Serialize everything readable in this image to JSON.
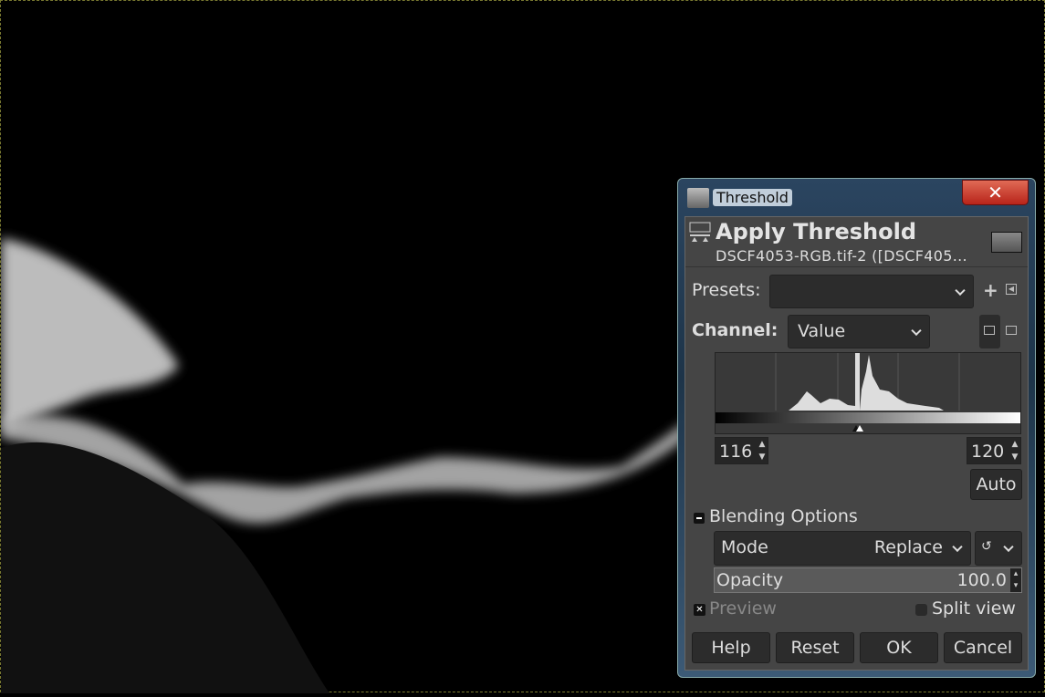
{
  "dialog": {
    "window_title": "Threshold",
    "close_label": "✕",
    "heading": "Apply Threshold",
    "subtitle": "DSCF4053-RGB.tif-2 ([DSCF405...",
    "presets_label": "Presets:",
    "presets_value": "",
    "channel_label": "Channel:",
    "channel_value": "Value",
    "low_value": "116",
    "high_value": "120",
    "auto_label": "Auto",
    "blending_label": "Blending Options",
    "mode_label": "Mode",
    "mode_value": "Replace",
    "opacity_label": "Opacity",
    "opacity_value": "100.0",
    "preview_label": "Preview",
    "preview_checked": true,
    "split_label": "Split view",
    "split_checked": false,
    "buttons": {
      "help": "Help",
      "reset": "Reset",
      "ok": "OK",
      "cancel": "Cancel"
    }
  }
}
